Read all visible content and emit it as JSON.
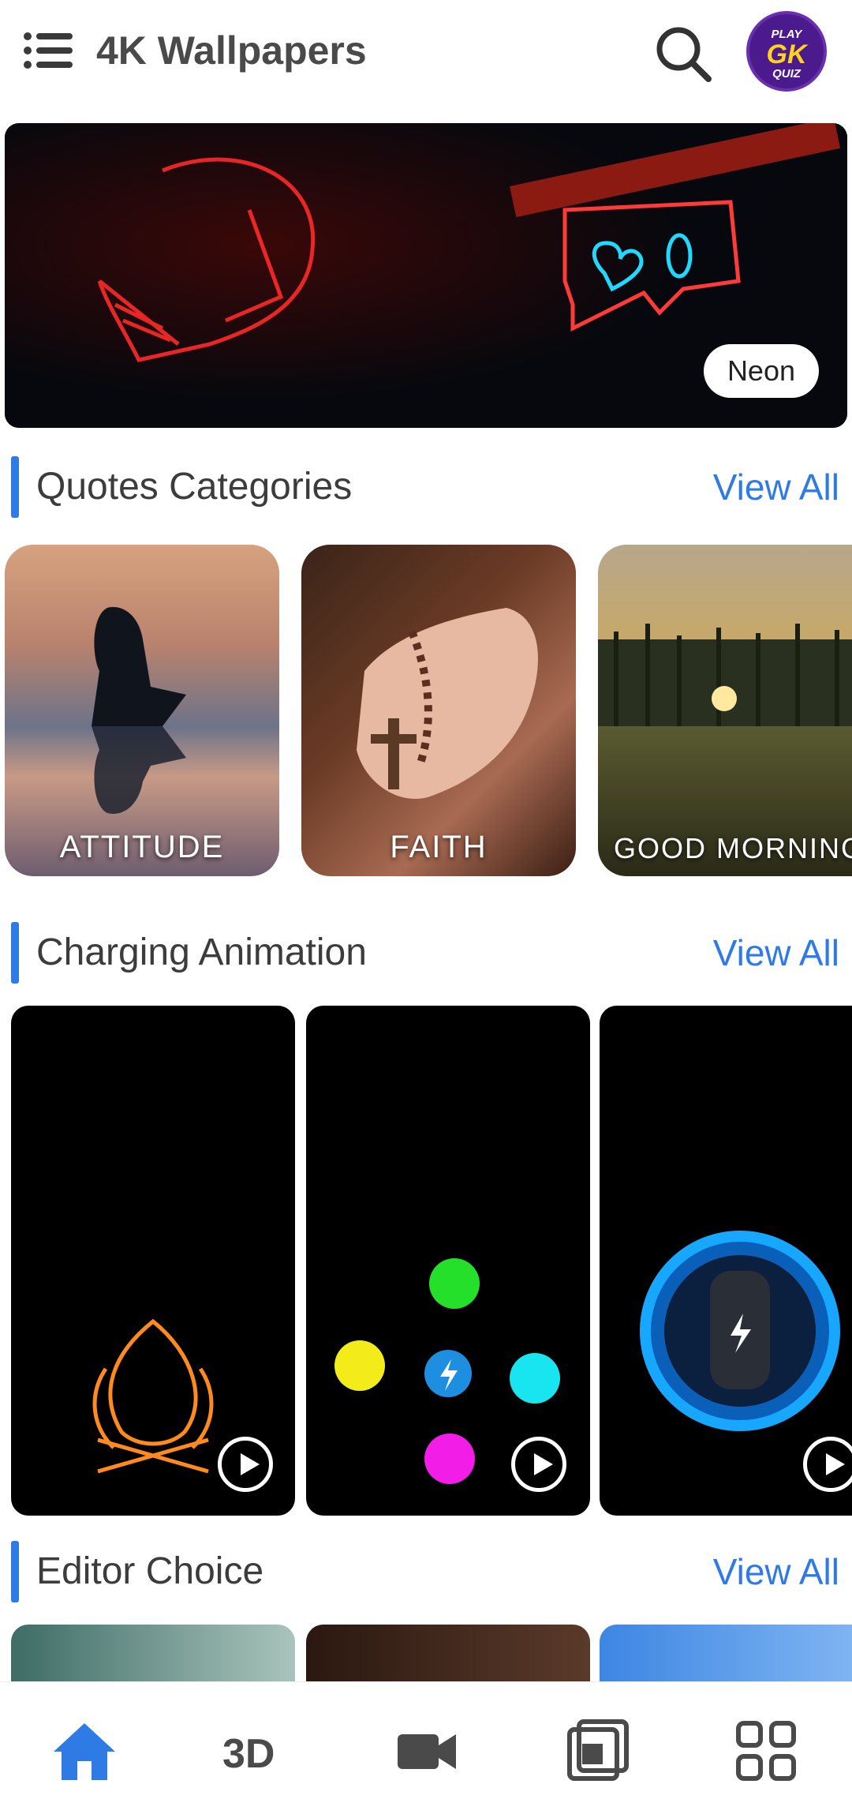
{
  "header": {
    "title": "4K Wallpapers",
    "badge": {
      "line1": "PLAY",
      "line2": "GK",
      "line3": "QUIZ"
    }
  },
  "banner": {
    "tag": "Neon"
  },
  "sections": {
    "quotes": {
      "title": "Quotes Categories",
      "view_all": "View All"
    },
    "charging": {
      "title": "Charging Animation",
      "view_all": "View All"
    },
    "editor": {
      "title": "Editor Choice",
      "view_all": "View All"
    }
  },
  "quote_cards": [
    "ATTITUDE",
    "FAITH",
    "GOOD MORNING"
  ],
  "nav": [
    "home-icon",
    "3d-icon",
    "video-icon",
    "gallery-icon",
    "grid-icon"
  ],
  "colors": {
    "accent": "#2f7be6",
    "nav_active": "#2f7be6",
    "nav_inactive": "#4a4a4a"
  }
}
